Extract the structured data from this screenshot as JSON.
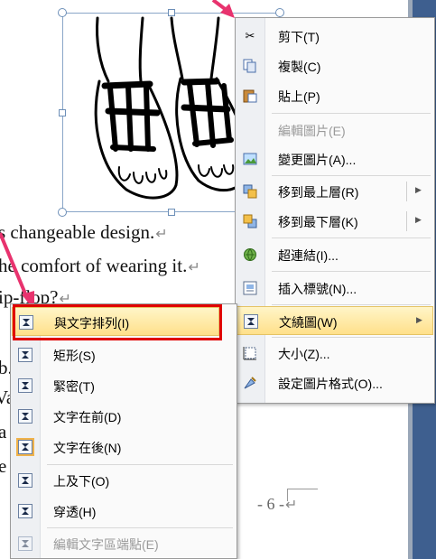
{
  "document": {
    "lines": [
      "s changeable design.",
      "he comfort of wearing it.",
      "ip-flop?",
      "b.",
      "Va",
      "a",
      "e"
    ],
    "page_number": "- 6 -"
  },
  "colors": {
    "highlight": "#ffe08a",
    "annotation_red": "#e00000",
    "arrow_pink": "#e8336e",
    "scrollbar": "#3e5f8f"
  },
  "context_menu": {
    "items": [
      {
        "label": "剪下(T)",
        "icon": "scissors-icon",
        "enabled": true
      },
      {
        "label": "複製(C)",
        "icon": "copy-icon",
        "enabled": true
      },
      {
        "label": "貼上(P)",
        "icon": "paste-icon",
        "enabled": true
      },
      {
        "label": "編輯圖片(E)",
        "icon": "",
        "enabled": false
      },
      {
        "label": "變更圖片(A)...",
        "icon": "change-picture-icon",
        "enabled": true
      },
      {
        "label": "移到最上層(R)",
        "icon": "bring-to-front-icon",
        "enabled": true,
        "submenu": true
      },
      {
        "label": "移到最下層(K)",
        "icon": "send-to-back-icon",
        "enabled": true,
        "submenu": true
      },
      {
        "label": "超連結(I)...",
        "icon": "hyperlink-icon",
        "enabled": true
      },
      {
        "label": "插入標號(N)...",
        "icon": "caption-icon",
        "enabled": true
      },
      {
        "label": "文繞圖(W)",
        "icon": "text-wrap-icon",
        "enabled": true,
        "submenu": true,
        "highlighted": true
      },
      {
        "label": "大小(Z)...",
        "icon": "size-icon",
        "enabled": true
      },
      {
        "label": "設定圖片格式(O)...",
        "icon": "format-picture-icon",
        "enabled": true
      }
    ]
  },
  "wrap_submenu": {
    "items": [
      {
        "label": "與文字排列(I)",
        "icon": "inline-wrap-icon",
        "enabled": true,
        "highlighted": true
      },
      {
        "label": "矩形(S)",
        "icon": "square-wrap-icon",
        "enabled": true
      },
      {
        "label": "緊密(T)",
        "icon": "tight-wrap-icon",
        "enabled": true
      },
      {
        "label": "文字在前(D)",
        "icon": "in-front-of-text-icon",
        "enabled": true
      },
      {
        "label": "文字在後(N)",
        "icon": "behind-text-icon",
        "enabled": true,
        "selected": true
      },
      {
        "label": "上及下(O)",
        "icon": "top-bottom-wrap-icon",
        "enabled": true
      },
      {
        "label": "穿透(H)",
        "icon": "through-wrap-icon",
        "enabled": true
      },
      {
        "label": "編輯文字區端點(E)",
        "icon": "edit-wrap-points-icon",
        "enabled": false
      }
    ]
  }
}
